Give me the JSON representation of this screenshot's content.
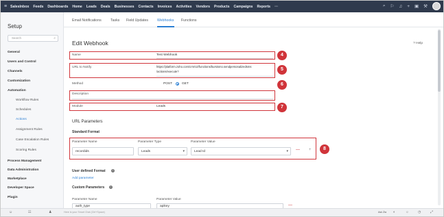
{
  "topnav": {
    "menu_icon": "hamburger-icon",
    "items": [
      "SalesInbox",
      "Feeds",
      "Dashboards",
      "Home",
      "Leads",
      "Deals",
      "Businesses",
      "Contacts",
      "Invoices",
      "Activities",
      "Vendors",
      "Products",
      "Campaigns",
      "Reports",
      "···"
    ],
    "icons": [
      "search-icon",
      "bell-icon",
      "notification-icon",
      "add-icon",
      "calendar-icon",
      "settings-icon"
    ]
  },
  "sidebar": {
    "title": "Setup",
    "search_placeholder": "Search",
    "items": [
      {
        "label": "General",
        "level": "head"
      },
      {
        "label": "Users and Control",
        "level": "head"
      },
      {
        "label": "Channels",
        "level": "head"
      },
      {
        "label": "Customization",
        "level": "head"
      },
      {
        "label": "Automation",
        "level": "head"
      },
      {
        "label": "Workflow Rules",
        "level": "sub"
      },
      {
        "label": "Schedules",
        "level": "sub"
      },
      {
        "label": "Actions",
        "level": "sub",
        "active": true
      },
      {
        "label": "Assignment Rules",
        "level": "sub"
      },
      {
        "label": "Case Escalation Rules",
        "level": "sub"
      },
      {
        "label": "Scoring Rules",
        "level": "sub"
      },
      {
        "label": "Process Management",
        "level": "head"
      },
      {
        "label": "Data Administration",
        "level": "head"
      },
      {
        "label": "Marketplace",
        "level": "head"
      },
      {
        "label": "Developer Space",
        "level": "head"
      },
      {
        "label": "Plugin",
        "level": "head"
      }
    ]
  },
  "tabs": [
    "Email Notifications",
    "Tasks",
    "Field Updates",
    "Webhooks",
    "Functions"
  ],
  "active_tab": "Webhooks",
  "form": {
    "title": "Edit Webhook",
    "help": "Help",
    "name_label": "Name",
    "name_value": "Test Webhook",
    "url_label": "URL to Notify",
    "url_value_line1": "https://platform.zoho.com/crm/v2/functions/bursismo.sendpersonalizedsms",
    "url_value_line2": "/actions/execute?",
    "method_label": "Method",
    "method_post": "POST",
    "method_get": "GET",
    "method_selected": "GET",
    "description_label": "Description",
    "module_label": "Module",
    "module_value": "Leads"
  },
  "url_params": {
    "title": "URL Parameters",
    "standard_format": "Standard Format",
    "col_name": "Parameter Name",
    "col_type": "Parameter Type",
    "col_value": "Parameter Value",
    "row": {
      "name": "recordids",
      "type": "Leads",
      "value": "Lead Id"
    },
    "user_defined": "User defined Format",
    "add_parameter": "Add parameter",
    "custom_title": "Custom Parameters",
    "custom_col_name": "Parameter Name",
    "custom_col_value": "Parameter Value",
    "custom_row": {
      "name": "auth_type",
      "value": "apikey"
    }
  },
  "badges": [
    "4",
    "5",
    "6",
    "7",
    "8"
  ],
  "bottombar": {
    "chat_placeholder": "Here is your Smart Chat (Ctrl+Space)",
    "right_text": "Ask Zia"
  },
  "colors": {
    "accent": "#2a7ed3",
    "nav": "#2f3a4d",
    "highlight": "#d0343a"
  }
}
